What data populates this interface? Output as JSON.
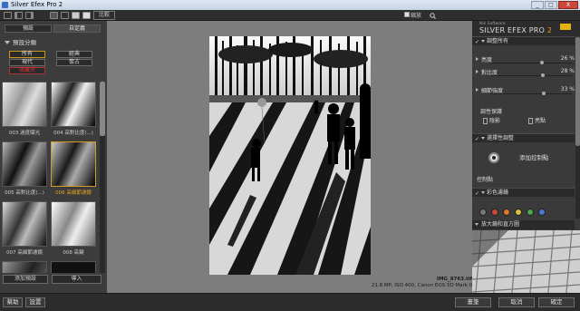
{
  "window": {
    "title": "Silver Efex Pro 2",
    "buttons": [
      "_",
      "□",
      "X"
    ]
  },
  "toolbar": {
    "compare_label": "比較",
    "zoom_label": "縮放",
    "zoom_checked": true
  },
  "left_panel": {
    "tabs": [
      "預設",
      "自定義"
    ],
    "section_title": "預設分類",
    "categories": [
      "所有",
      "經典",
      "現代",
      "懷古",
      "收藏夾"
    ],
    "selected_category": "所有",
    "thumbnails": [
      {
        "caption": "003 過度曝光"
      },
      {
        "caption": "004 高對比度(...)"
      },
      {
        "caption": "005 高對比度(...)"
      },
      {
        "caption": "006 高細節濾鏡"
      },
      {
        "caption": "007 高細節濾鏡"
      },
      {
        "caption": "008 高鍵"
      }
    ],
    "selected_thumbnail": 3,
    "add_preset_label": "添加預設",
    "import_label": "導入"
  },
  "canvas": {
    "filename": "IMG_8763.tif",
    "info": "21.8 MP, ISO 400, Canon EOS 5D Mark II"
  },
  "right_panel": {
    "brand_top": "Nik Software",
    "brand_name": "SILVER EFEX PRO",
    "brand_version": "2",
    "accent_color": "#e8a020",
    "global_adjust_title": "調整所有",
    "sliders": [
      {
        "label": "亮度",
        "value": "26 %",
        "level": 0.63
      },
      {
        "label": "對比度",
        "value": "28 %",
        "level": 0.64
      },
      {
        "label": "細節強度",
        "value": "33 %",
        "level": 0.66
      }
    ],
    "protection_label": "調性保護",
    "protection_shadows": "陰影",
    "protection_highlights": "亮點",
    "selective_title": "選擇性調整",
    "add_control_point": "添加控制點",
    "control_points": "控制點",
    "color_filter_title": "彩色濾鏡",
    "filter_colors": [
      "#7a7a7a",
      "#c84b3a",
      "#e07a2a",
      "#d8c23a",
      "#4caa4a",
      "#4a7ad0"
    ],
    "loupe_title": "放大鏡和直方圖"
  },
  "bottom": {
    "help_label": "幫助",
    "settings_label": "設置",
    "brush_label": "畫筆",
    "cancel_label": "取消",
    "ok_label": "確定"
  }
}
